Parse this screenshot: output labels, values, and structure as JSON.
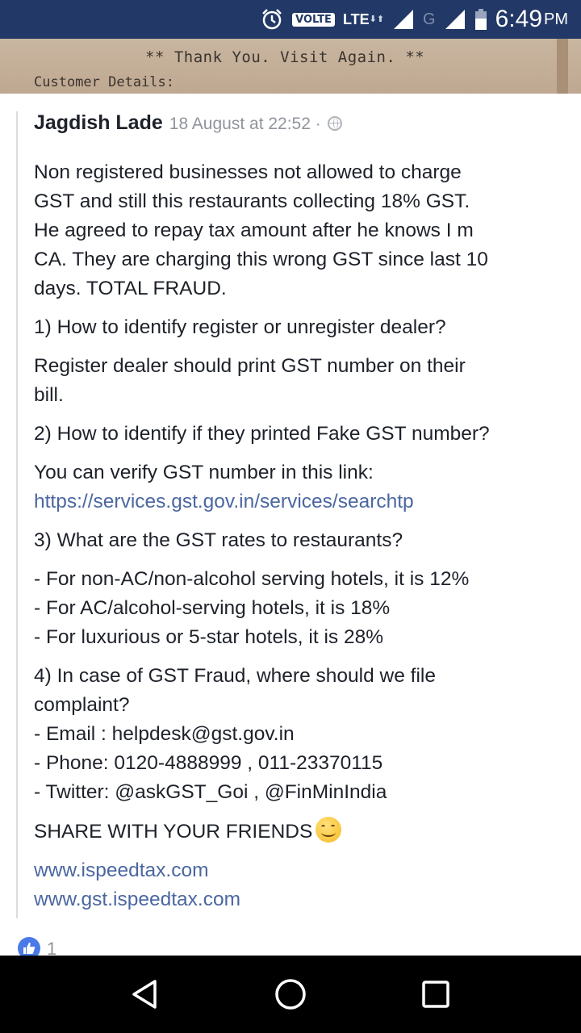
{
  "status_bar": {
    "volte": "VOLTE",
    "lte": "LTE",
    "network_g": "G",
    "time": "6:49",
    "ampm": "PM",
    "icons": [
      "alarm-icon",
      "signal-icon",
      "signal-icon",
      "battery-icon"
    ]
  },
  "receipt": {
    "line1": "** Thank You. Visit Again. **",
    "line2": "Customer Details:"
  },
  "comment": {
    "author": "Jagdish Lade",
    "timestamp": "18 August at 22:52 ·",
    "privacy_icon": "globe-icon",
    "paragraphs": [
      {
        "lines": [
          "Non registered businesses not allowed to charge",
          "GST and still this restaurants collecting 18% GST.",
          "He agreed to repay tax amount after he knows I m",
          "CA. They are charging this wrong GST since last 10",
          "days. TOTAL FRAUD."
        ]
      },
      {
        "lines": [
          "1) How to identify register or unregister dealer?"
        ]
      },
      {
        "lines": [
          "Register dealer should print GST number on their",
          "bill."
        ]
      },
      {
        "lines": [
          "2) How to identify if they printed Fake GST number?"
        ]
      },
      {
        "lines": [
          "You can verify GST number in this link:"
        ],
        "link": "https://services.gst.gov.in/services/searchtp"
      },
      {
        "lines": [
          "3) What are the GST rates to restaurants?"
        ]
      },
      {
        "lines": [
          "- For non-AC/non-alcohol serving hotels, it is 12%",
          "- For AC/alcohol-serving hotels, it is 18%",
          "- For luxurious or 5-star hotels, it is 28%"
        ]
      },
      {
        "lines": [
          "4) In case of GST Fraud, where should we file",
          "complaint?",
          "- Email : helpdesk@gst.gov.in",
          "- Phone: 0120-4888999 , 011-23370115",
          "- Twitter: @askGST_Goi , @FinMinIndia"
        ]
      },
      {
        "lines": [
          "SHARE WITH YOUR FRIENDS"
        ],
        "emoji": "smiling-face-icon"
      },
      {
        "links": [
          "www.ispeedtax.com",
          "www.gst.ispeedtax.com"
        ]
      }
    ]
  },
  "reactions": {
    "icon": "like-icon",
    "count": "1"
  },
  "nav_bar": {
    "icons": [
      "back-icon",
      "home-icon",
      "recents-icon"
    ]
  },
  "colors": {
    "status_bar_bg": "#223867",
    "link": "#4b67a1",
    "text": "#1d2129",
    "meta": "#90949c",
    "like": "#4a7ae8"
  }
}
